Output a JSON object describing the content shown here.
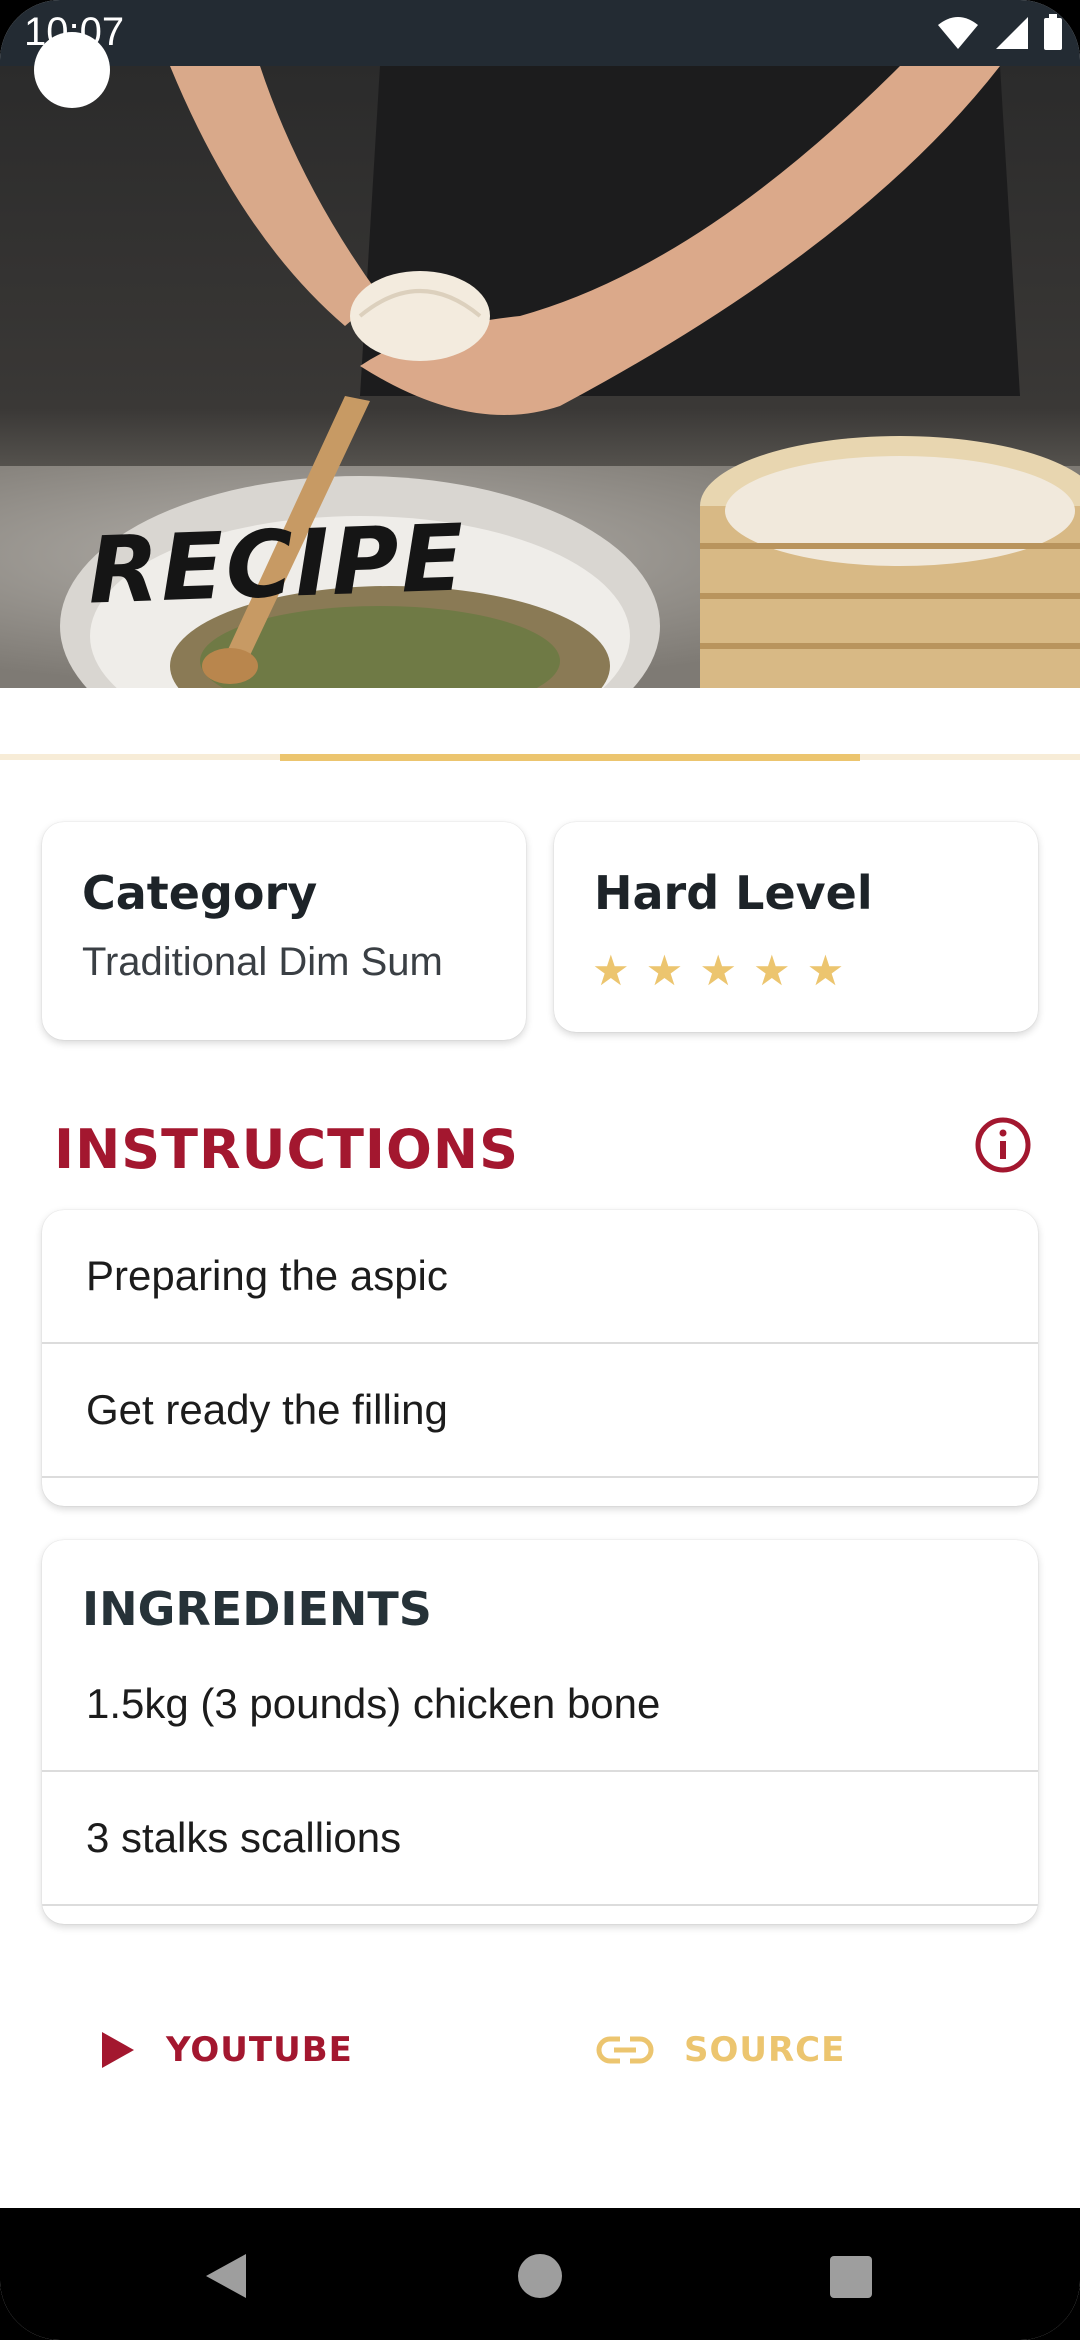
{
  "status_bar": {
    "time": "10:07"
  },
  "hero": {
    "title": "RECIPE"
  },
  "category_card": {
    "title": "Category",
    "value": "Traditional Dim Sum"
  },
  "difficulty_card": {
    "title": "Hard Level",
    "rating": 5,
    "max_rating": 5,
    "star_glyph": "★"
  },
  "instructions": {
    "header": "INSTRUCTIONS",
    "items": [
      "Preparing the aspic",
      "Get ready the filling"
    ]
  },
  "ingredients": {
    "header": "INGREDIENTS",
    "items": [
      "1.5kg (3 pounds) chicken bone",
      "3 stalks scallions"
    ]
  },
  "actions": {
    "youtube": "YOUTUBE",
    "source": "SOURCE"
  },
  "colors": {
    "primary": "#a3172f",
    "accent": "#ecc56f",
    "text": "#1d2328"
  }
}
